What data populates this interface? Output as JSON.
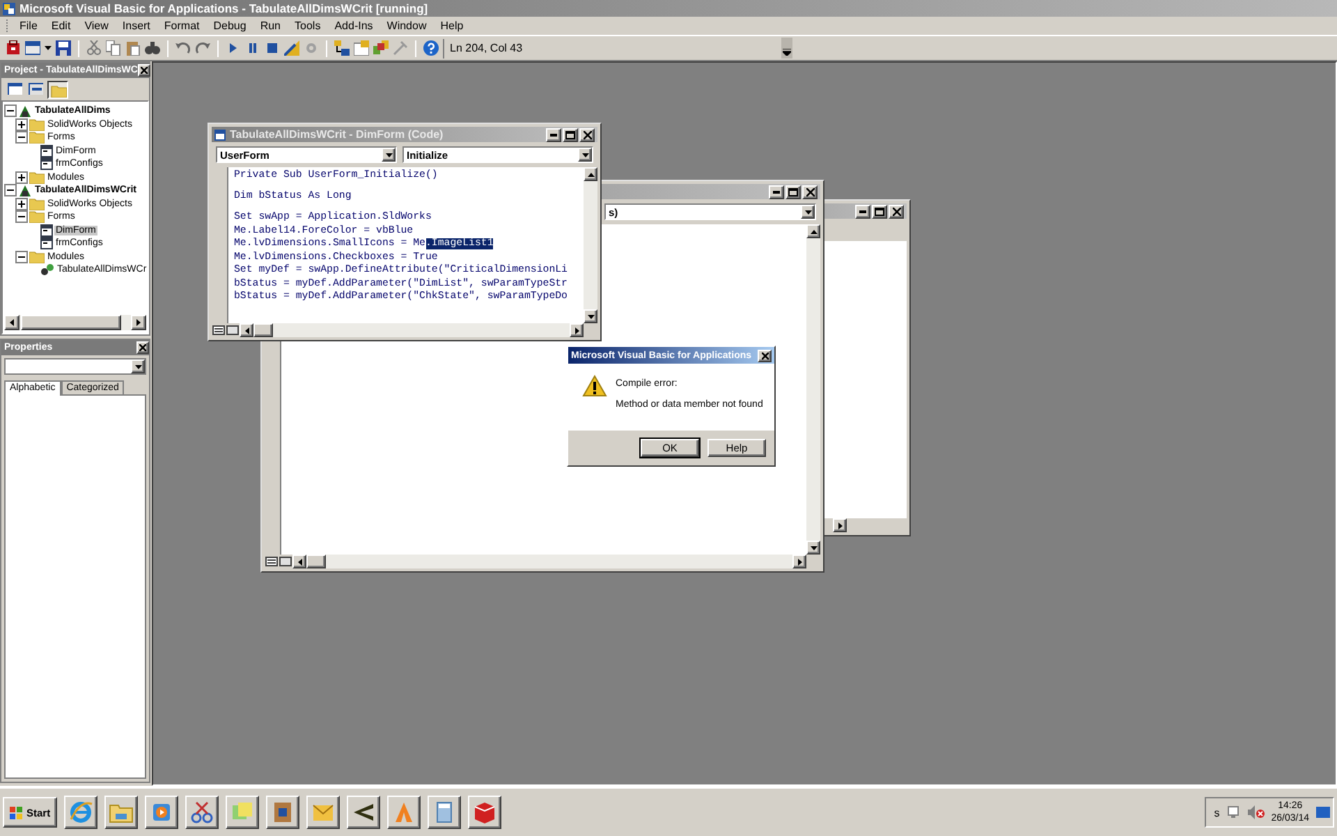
{
  "window": {
    "title": "Microsoft Visual Basic for Applications - TabulateAllDimsWCrit [running]"
  },
  "menu": [
    "File",
    "Edit",
    "View",
    "Insert",
    "Format",
    "Debug",
    "Run",
    "Tools",
    "Add-Ins",
    "Window",
    "Help"
  ],
  "toolbar": {
    "position": "Ln 204, Col 43"
  },
  "project": {
    "title": "Project - TabulateAllDimsWC",
    "tree": [
      {
        "label": "TabulateAllDims",
        "kind": "project",
        "expanded": true,
        "selected": false,
        "children": [
          {
            "label": "SolidWorks Objects",
            "kind": "folder",
            "expanded": false,
            "selected": false
          },
          {
            "label": "Forms",
            "kind": "folder",
            "expanded": true,
            "selected": false,
            "children": [
              {
                "label": "DimForm",
                "kind": "form",
                "selected": false
              },
              {
                "label": "frmConfigs",
                "kind": "form",
                "selected": false
              }
            ]
          },
          {
            "label": "Modules",
            "kind": "folder",
            "expanded": false,
            "selected": false
          }
        ]
      },
      {
        "label": "TabulateAllDimsWCrit",
        "kind": "project",
        "expanded": true,
        "selected": false,
        "children": [
          {
            "label": "SolidWorks Objects",
            "kind": "folder",
            "expanded": false,
            "selected": false
          },
          {
            "label": "Forms",
            "kind": "folder",
            "expanded": true,
            "selected": false,
            "children": [
              {
                "label": "DimForm",
                "kind": "form",
                "selected": true
              },
              {
                "label": "frmConfigs",
                "kind": "form",
                "selected": false
              }
            ]
          },
          {
            "label": "Modules",
            "kind": "folder",
            "expanded": true,
            "selected": false,
            "children": [
              {
                "label": "TabulateAllDimsWCr",
                "kind": "module",
                "selected": false
              }
            ]
          }
        ]
      }
    ]
  },
  "properties": {
    "title": "Properties",
    "tabs": [
      {
        "label": "Alphabetic",
        "selected": true
      },
      {
        "label": "Categorized",
        "selected": false
      }
    ]
  },
  "back_window": {
    "object_combo": "s)"
  },
  "code_window": {
    "title": "TabulateAllDimsWCrit - DimForm (Code)",
    "object": "UserForm",
    "procedure": "Initialize",
    "blocks": [
      [
        {
          "text": "Private Sub UserForm_Initialize()"
        }
      ],
      [
        {
          "text": "Dim bStatus As Long"
        }
      ],
      [
        {
          "text": "Set swApp = Application.SldWorks"
        },
        {
          "text": "Me.Label14.ForeColor = vbBlue"
        },
        {
          "text": "Me.lvDimensions.SmallIcons = Me",
          "selection": ".ImageList1"
        },
        {
          "text": "Me.lvDimensions.Checkboxes = True"
        },
        {
          "text": "Set myDef = swApp.DefineAttribute(\"CriticalDimensionLi"
        },
        {
          "text": "bStatus = myDef.AddParameter(\"DimList\", swParamTypeStr"
        },
        {
          "text": "bStatus = myDef.AddParameter(\"ChkState\", swParamTypeDo"
        }
      ]
    ]
  },
  "dialog": {
    "title": "Microsoft Visual Basic for Applications",
    "heading": "Compile error:",
    "message": "Method or data member not found",
    "buttons": [
      "OK",
      "Help"
    ]
  },
  "taskbar": {
    "start": "Start",
    "tray_label": "s",
    "time": "14:26",
    "date": "26/03/14"
  }
}
